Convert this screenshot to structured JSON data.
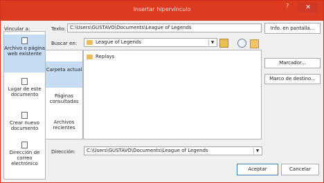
{
  "window": {
    "title": "Insertar hipervínculo",
    "help": "?",
    "close": "✕"
  },
  "link_to_label": "Vincular a:",
  "text_field": {
    "label": "Texto:",
    "value": "C:\\Users\\GUSTAVO\\Documents\\League of Legends"
  },
  "screentip_button": "Info. en pantalla...",
  "nav": [
    {
      "label": "Archivo o página web existente"
    },
    {
      "label": "Lugar de este documento"
    },
    {
      "label": "Crear nuevo documento"
    },
    {
      "label": "Dirección de correo electrónico"
    }
  ],
  "lookin": {
    "label": "Buscar en:",
    "value": "League of Legends"
  },
  "scope": [
    {
      "label": "Carpeta actual"
    },
    {
      "label": "Páginas consultadas"
    },
    {
      "label": "Archivos recientes"
    }
  ],
  "files": [
    {
      "name": "Replays"
    }
  ],
  "bookmark_button": "Marcador...",
  "target_frame_button": "Marco de destino...",
  "address": {
    "label": "Dirección:",
    "value": "C:\\Users\\GUSTAVO\\Documents\\League of Legends"
  },
  "ok_button": "Aceptar",
  "cancel_button": "Cancelar"
}
